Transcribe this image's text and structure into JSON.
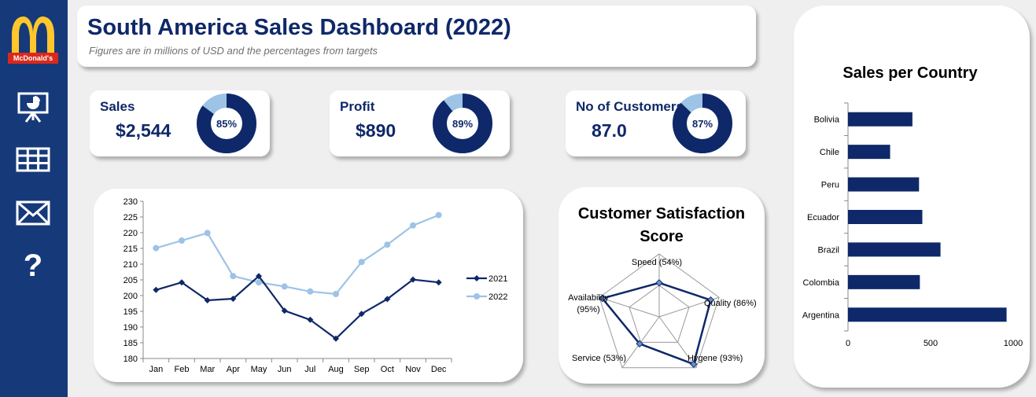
{
  "brand": {
    "logo_text": "McDonald's"
  },
  "sidebar": {
    "items": [
      {
        "icon": "presentation-chart-icon"
      },
      {
        "icon": "table-grid-icon"
      },
      {
        "icon": "envelope-icon"
      },
      {
        "icon": "question-mark-icon",
        "glyph": "?"
      }
    ]
  },
  "header": {
    "title": "South America Sales Dashboard (2022)",
    "subtitle": "Figures are in millions of USD and  the percentages from targets"
  },
  "kpis": [
    {
      "label": "Sales",
      "value": "$2,544",
      "percent_label": "85%",
      "percent": 0.85
    },
    {
      "label": "Profit",
      "value": "$890",
      "percent_label": "89%",
      "percent": 0.89
    },
    {
      "label": "No of Customers",
      "value": "87.0",
      "percent_label": "87%",
      "percent": 0.87
    }
  ],
  "colors": {
    "navy": "#0f2869",
    "light_blue": "#9dc3e6",
    "sidebar": "#16397a",
    "logo_red": "#da291c",
    "logo_yellow": "#ffc72c"
  },
  "chart_data": [
    {
      "type": "line",
      "categories": [
        "Jan",
        "Feb",
        "Mar",
        "Apr",
        "May",
        "Jun",
        "Jul",
        "Aug",
        "Sep",
        "Oct",
        "Nov",
        "Dec"
      ],
      "series": [
        {
          "name": "2021",
          "values": [
            201.8,
            204.2,
            198.5,
            199.0,
            206.2,
            195.2,
            192.3,
            186.3,
            194.2,
            198.9,
            205.1,
            204.2
          ]
        },
        {
          "name": "2022",
          "values": [
            215.1,
            217.5,
            219.9,
            206.2,
            204.2,
            202.9,
            201.3,
            200.5,
            210.7,
            216.2,
            222.3,
            225.6
          ]
        }
      ],
      "ylim": [
        180,
        230
      ],
      "yticks": [
        180,
        185,
        190,
        195,
        200,
        205,
        210,
        215,
        220,
        225,
        230
      ],
      "legend": "right"
    },
    {
      "type": "radar",
      "title": "Customer Satisfaction Score",
      "axes": [
        {
          "name": "Speed",
          "label": "Speed (54%)",
          "value": 54
        },
        {
          "name": "Quality",
          "label": "Quality (86%)",
          "value": 86
        },
        {
          "name": "Hygene",
          "label": "Hygene (93%)",
          "value": 93
        },
        {
          "name": "Service",
          "label": "Service (53%)",
          "value": 53
        },
        {
          "name": "Availability",
          "label_lines": [
            "Availability",
            "(95%)"
          ],
          "value": 95
        }
      ],
      "rmax": 100,
      "grid_levels": [
        50,
        100
      ]
    },
    {
      "type": "bar",
      "orientation": "horizontal",
      "title": "Sales per Country",
      "categories": [
        "Bolivia",
        "Chile",
        "Peru",
        "Ecuador",
        "Brazil",
        "Colombia",
        "Argentina"
      ],
      "values": [
        390,
        255,
        430,
        450,
        560,
        435,
        960
      ],
      "xlim": [
        0,
        1000
      ],
      "xticks": [
        0,
        500,
        1000
      ]
    }
  ]
}
